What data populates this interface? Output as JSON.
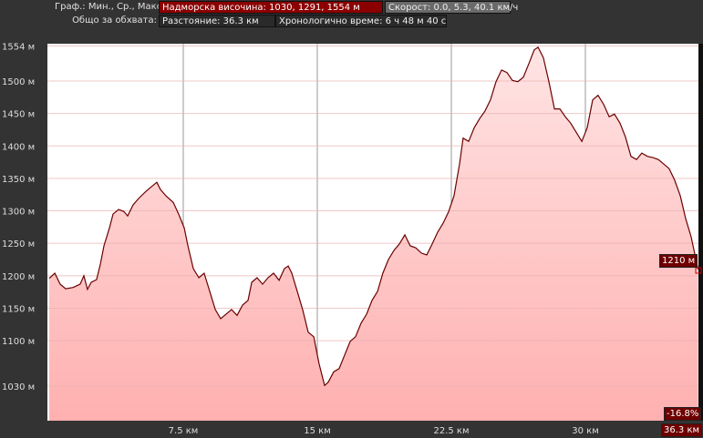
{
  "header": {
    "graph_label": "Граф.: Мин., Ср., Макс.",
    "elevation": "Надморска височина: 1030, 1291, 1554 м",
    "speed": "Скорост: 0.0, 5.3, 40.1 км/ч",
    "total_label": "Общо за обхвата:",
    "distance": "Разстояние: 36.3 км",
    "time": "Хронологично време: 6 ч 48 м 40 с"
  },
  "colors": {
    "line": "#6b0000",
    "fill_top": "#ffe4e4",
    "fill_bottom": "#ffb0b0",
    "accent": "#8b0000"
  },
  "chart_data": {
    "type": "area",
    "title": "",
    "xlabel": "",
    "ylabel": "",
    "xlim": [
      0,
      36.3
    ],
    "ylim": [
      977,
      1560
    ],
    "grid": true,
    "x_ticks": [
      {
        "v": 7.5,
        "label": "7.5 км"
      },
      {
        "v": 15,
        "label": "15 км"
      },
      {
        "v": 22.5,
        "label": "22.5 км"
      },
      {
        "v": 30,
        "label": "30 км"
      }
    ],
    "y_ticks": [
      {
        "v": 1554,
        "label": "1554 м"
      },
      {
        "v": 1500,
        "label": "1500 м"
      },
      {
        "v": 1450,
        "label": "1450 м"
      },
      {
        "v": 1400,
        "label": "1400 м"
      },
      {
        "v": 1350,
        "label": "1350 м"
      },
      {
        "v": 1300,
        "label": "1300 м"
      },
      {
        "v": 1250,
        "label": "1250 м"
      },
      {
        "v": 1200,
        "label": "1200 м"
      },
      {
        "v": 1150,
        "label": "1150 м"
      },
      {
        "v": 1100,
        "label": "1100 м"
      },
      {
        "v": 1030,
        "label": "1030 м"
      }
    ],
    "cursor": {
      "elevation_label": "1210 м",
      "grade_label": "-16.8%",
      "distance_label": "36.3 км"
    },
    "km": [
      0,
      0.31,
      0.61,
      0.92,
      1.33,
      1.73,
      1.94,
      2.14,
      2.35,
      2.65,
      2.86,
      3.06,
      3.37,
      3.57,
      3.88,
      4.18,
      4.39,
      4.69,
      5.0,
      5.41,
      5.71,
      6.02,
      6.22,
      6.53,
      6.94,
      7.24,
      7.55,
      7.76,
      8.06,
      8.37,
      8.67,
      8.98,
      9.29,
      9.59,
      9.9,
      10.2,
      10.51,
      10.82,
      11.12,
      11.33,
      11.63,
      11.94,
      12.24,
      12.55,
      12.86,
      13.16,
      13.37,
      13.57,
      13.88,
      14.18,
      14.49,
      14.8,
      15.1,
      15.41,
      15.61,
      15.92,
      16.22,
      16.53,
      16.84,
      17.14,
      17.45,
      17.76,
      18.06,
      18.37,
      18.67,
      18.98,
      19.29,
      19.59,
      19.9,
      20.2,
      20.51,
      20.82,
      21.12,
      21.43,
      21.73,
      22.04,
      22.35,
      22.65,
      22.96,
      23.16,
      23.47,
      23.78,
      24.08,
      24.39,
      24.69,
      25.0,
      25.31,
      25.61,
      25.92,
      26.22,
      26.53,
      26.84,
      27.14,
      27.35,
      27.65,
      27.96,
      28.27,
      28.57,
      28.88,
      29.18,
      29.49,
      29.8,
      30.1,
      30.41,
      30.71,
      31.02,
      31.33,
      31.63,
      31.94,
      32.24,
      32.55,
      32.86,
      33.16,
      33.47,
      33.78,
      34.08,
      34.39,
      34.69,
      35.0,
      35.31,
      35.61,
      35.92,
      36.22,
      36.3
    ],
    "elevation": [
      1196,
      1204,
      1187,
      1180,
      1182,
      1187,
      1200,
      1179,
      1190,
      1194,
      1218,
      1246,
      1274,
      1295,
      1302,
      1299,
      1292,
      1309,
      1319,
      1330,
      1337,
      1344,
      1333,
      1323,
      1313,
      1295,
      1274,
      1246,
      1211,
      1197,
      1204,
      1176,
      1148,
      1134,
      1141,
      1148,
      1139,
      1155,
      1162,
      1190,
      1197,
      1187,
      1197,
      1204,
      1193,
      1211,
      1215,
      1204,
      1176,
      1148,
      1113,
      1106,
      1064,
      1031,
      1036,
      1052,
      1057,
      1078,
      1099,
      1106,
      1127,
      1141,
      1162,
      1176,
      1204,
      1225,
      1239,
      1249,
      1263,
      1246,
      1243,
      1235,
      1232,
      1249,
      1267,
      1281,
      1299,
      1323,
      1372,
      1412,
      1407,
      1428,
      1442,
      1454,
      1471,
      1499,
      1517,
      1513,
      1501,
      1499,
      1506,
      1527,
      1548,
      1552,
      1536,
      1499,
      1457,
      1457,
      1445,
      1435,
      1421,
      1407,
      1428,
      1471,
      1478,
      1464,
      1445,
      1449,
      1435,
      1414,
      1384,
      1379,
      1389,
      1384,
      1382,
      1379,
      1372,
      1365,
      1347,
      1323,
      1288,
      1260,
      1221,
      1210
    ]
  }
}
